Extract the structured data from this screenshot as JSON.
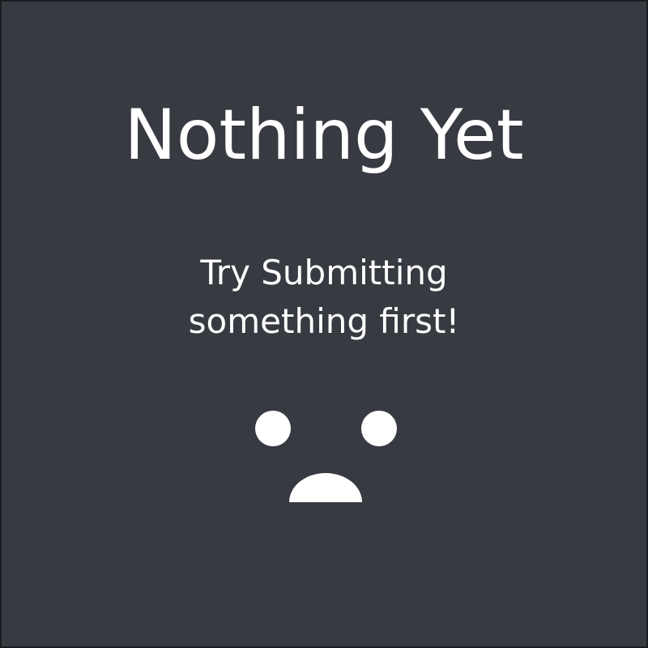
{
  "empty_state": {
    "title": "Nothing Yet",
    "message_line_1": "Try Submitting",
    "message_line_2": "something first!",
    "icon": "sad-face-icon"
  },
  "colors": {
    "background": "#373a41",
    "border": "#1a1c20",
    "foreground": "#ffffff"
  }
}
